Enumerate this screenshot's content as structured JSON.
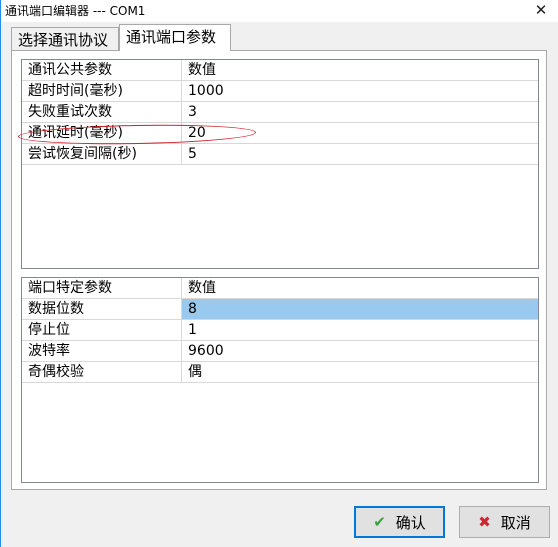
{
  "window": {
    "title": "通讯端口编辑器 --- COM1",
    "close_glyph": "✕"
  },
  "tabs": [
    {
      "label": "选择通讯协议",
      "active": false
    },
    {
      "label": "通讯端口参数",
      "active": true
    }
  ],
  "common_params": {
    "header": {
      "name": "通讯公共参数",
      "value": "数值"
    },
    "rows": [
      {
        "name": "超时时间(毫秒)",
        "value": "1000"
      },
      {
        "name": "失败重试次数",
        "value": "3"
      },
      {
        "name": "通讯延时(毫秒)",
        "value": "20"
      },
      {
        "name": "尝试恢复间隔(秒)",
        "value": "5"
      }
    ]
  },
  "port_params": {
    "header": {
      "name": "端口特定参数",
      "value": "数值"
    },
    "rows": [
      {
        "name": "数据位数",
        "value": "8"
      },
      {
        "name": "停止位",
        "value": "1"
      },
      {
        "name": "波特率",
        "value": "9600"
      },
      {
        "name": "奇偶校验",
        "value": "偶"
      }
    ]
  },
  "buttons": {
    "ok": {
      "icon": "check-icon",
      "glyph": "✔",
      "label": "确认"
    },
    "cancel": {
      "icon": "x-icon",
      "glyph": "✖",
      "label": "取消"
    }
  },
  "colors": {
    "selection": "#99c9ef",
    "annotation": "#d0202a",
    "ok_border": "#0078d7"
  }
}
